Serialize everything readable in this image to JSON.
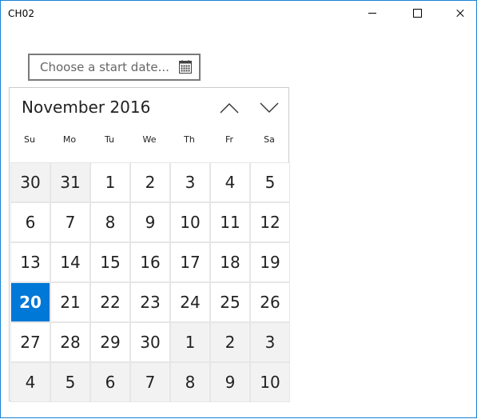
{
  "window": {
    "title": "CH02"
  },
  "datepicker": {
    "placeholder": "Choose a start date..."
  },
  "calendar": {
    "month_label": "November 2016",
    "weekdays": [
      "Su",
      "Mo",
      "Tu",
      "We",
      "Th",
      "Fr",
      "Sa"
    ],
    "weeks": [
      [
        {
          "d": "30",
          "o": true
        },
        {
          "d": "31",
          "o": true
        },
        {
          "d": "1"
        },
        {
          "d": "2"
        },
        {
          "d": "3"
        },
        {
          "d": "4"
        },
        {
          "d": "5"
        }
      ],
      [
        {
          "d": "6"
        },
        {
          "d": "7"
        },
        {
          "d": "8"
        },
        {
          "d": "9"
        },
        {
          "d": "10"
        },
        {
          "d": "11"
        },
        {
          "d": "12"
        }
      ],
      [
        {
          "d": "13"
        },
        {
          "d": "14"
        },
        {
          "d": "15"
        },
        {
          "d": "16"
        },
        {
          "d": "17"
        },
        {
          "d": "18"
        },
        {
          "d": "19"
        }
      ],
      [
        {
          "d": "20",
          "today": true
        },
        {
          "d": "21"
        },
        {
          "d": "22"
        },
        {
          "d": "23"
        },
        {
          "d": "24"
        },
        {
          "d": "25"
        },
        {
          "d": "26"
        }
      ],
      [
        {
          "d": "27"
        },
        {
          "d": "28"
        },
        {
          "d": "29"
        },
        {
          "d": "30"
        },
        {
          "d": "1",
          "o": true
        },
        {
          "d": "2",
          "o": true
        },
        {
          "d": "3",
          "o": true
        }
      ],
      [
        {
          "d": "4",
          "o": true
        },
        {
          "d": "5",
          "o": true
        },
        {
          "d": "6",
          "o": true
        },
        {
          "d": "7",
          "o": true
        },
        {
          "d": "8",
          "o": true
        },
        {
          "d": "9",
          "o": true
        },
        {
          "d": "10",
          "o": true
        }
      ]
    ]
  },
  "colors": {
    "accent": "#0078d7",
    "window_border": "#1883d7",
    "other_month_bg": "#f2f2f2",
    "grid_line": "#e6e6e6"
  },
  "icons": {
    "calendar": "calendar-icon",
    "prev": "chevron-up-icon",
    "next": "chevron-down-icon",
    "minimize": "minimize-icon",
    "maximize": "maximize-icon",
    "close": "close-icon"
  }
}
